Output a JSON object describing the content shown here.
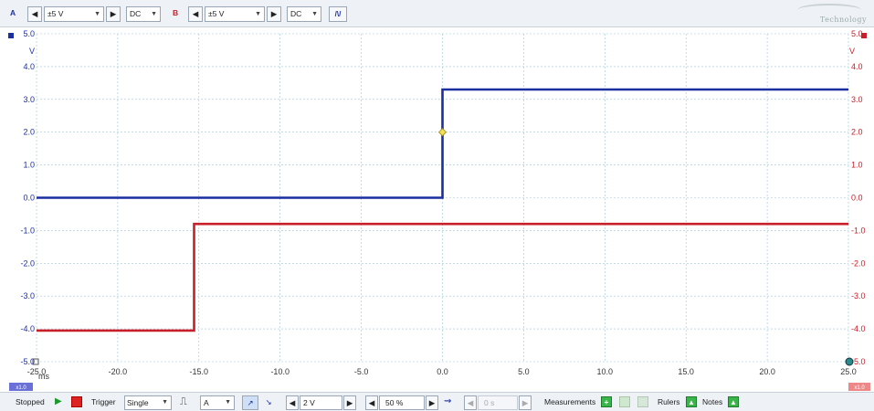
{
  "toolbar": {
    "channel_a": {
      "label": "A",
      "range": "±5 V",
      "coupling": "DC",
      "color": "#1a2fa0"
    },
    "channel_b": {
      "label": "B",
      "range": "±5 V",
      "coupling": "DC",
      "color": "#c8202a"
    },
    "math_icon": "waveform-math-icon",
    "logo_text": "Technology"
  },
  "axes": {
    "left_ticks": [
      "5.0",
      "4.0",
      "3.0",
      "2.0",
      "1.0",
      "0.0",
      "-1.0",
      "-2.0",
      "-3.0",
      "-4.0",
      "-5.0"
    ],
    "right_ticks": [
      "5.0",
      "4.0",
      "3.0",
      "2.0",
      "1.0",
      "0.0",
      "-1.0",
      "-2.0",
      "-3.0",
      "-4.0",
      "-5.0"
    ],
    "left_unit": "V",
    "right_unit": "V",
    "x_ticks": [
      "-25.0",
      "-20.0",
      "-15.0",
      "-10.0",
      "-5.0",
      "0.0",
      "5.0",
      "10.0",
      "15.0",
      "20.0",
      "25.0"
    ],
    "x_unit": "ms",
    "left_scale_badge": "x1.0",
    "right_scale_badge": "x1.0"
  },
  "chart_data": {
    "type": "line",
    "x_range": [
      -25,
      25
    ],
    "y_range": [
      -5,
      5
    ],
    "grid": true,
    "series": [
      {
        "channel": "A",
        "color": "#1a2fa0",
        "points": [
          [
            -25,
            0.0
          ],
          [
            0.0,
            0.0
          ],
          [
            0.0,
            3.3
          ],
          [
            25,
            3.3
          ]
        ]
      },
      {
        "channel": "B",
        "color": "#c8202a",
        "points": [
          [
            -25,
            -4.05
          ],
          [
            -15.3,
            -4.05
          ],
          [
            -15.3,
            -0.8
          ],
          [
            25,
            -0.8
          ]
        ]
      }
    ],
    "trigger_marker": {
      "x": 0.0,
      "y": 2.0
    }
  },
  "bottom": {
    "status": "Stopped",
    "trigger_label": "Trigger",
    "trigger_mode": "Single",
    "trigger_source": "A",
    "threshold": "2 V",
    "pre_trigger": "50 %",
    "delay": "0 s",
    "measurements_label": "Measurements",
    "rulers_label": "Rulers",
    "notes_label": "Notes"
  }
}
